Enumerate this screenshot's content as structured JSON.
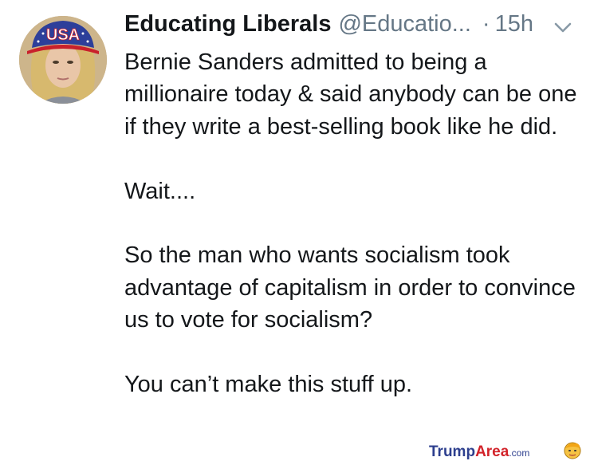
{
  "tweet": {
    "author_name": "Educating Liberals",
    "author_handle": "@Educatio...",
    "separator": "·",
    "timestamp": "15h",
    "avatar_text": "USA",
    "paragraphs": [
      "Bernie Sanders admitted to being a millionaire today & said anybody can be one if they write a best-selling book like he did.",
      "Wait....",
      "So the man who wants socialism took advantage of capitalism in order to convince us to vote for socialism?",
      "You can’t make this stuff up."
    ]
  },
  "watermark": {
    "part1": "Trump",
    "part2": "Area",
    "part3": ".com"
  },
  "icons": {
    "menu": "chevron-down-icon",
    "logo": "trump-face-icon"
  },
  "colors": {
    "text": "#14171a",
    "secondary": "#657786",
    "watermark_blue": "#2d3f8e",
    "watermark_red": "#d2232a"
  }
}
